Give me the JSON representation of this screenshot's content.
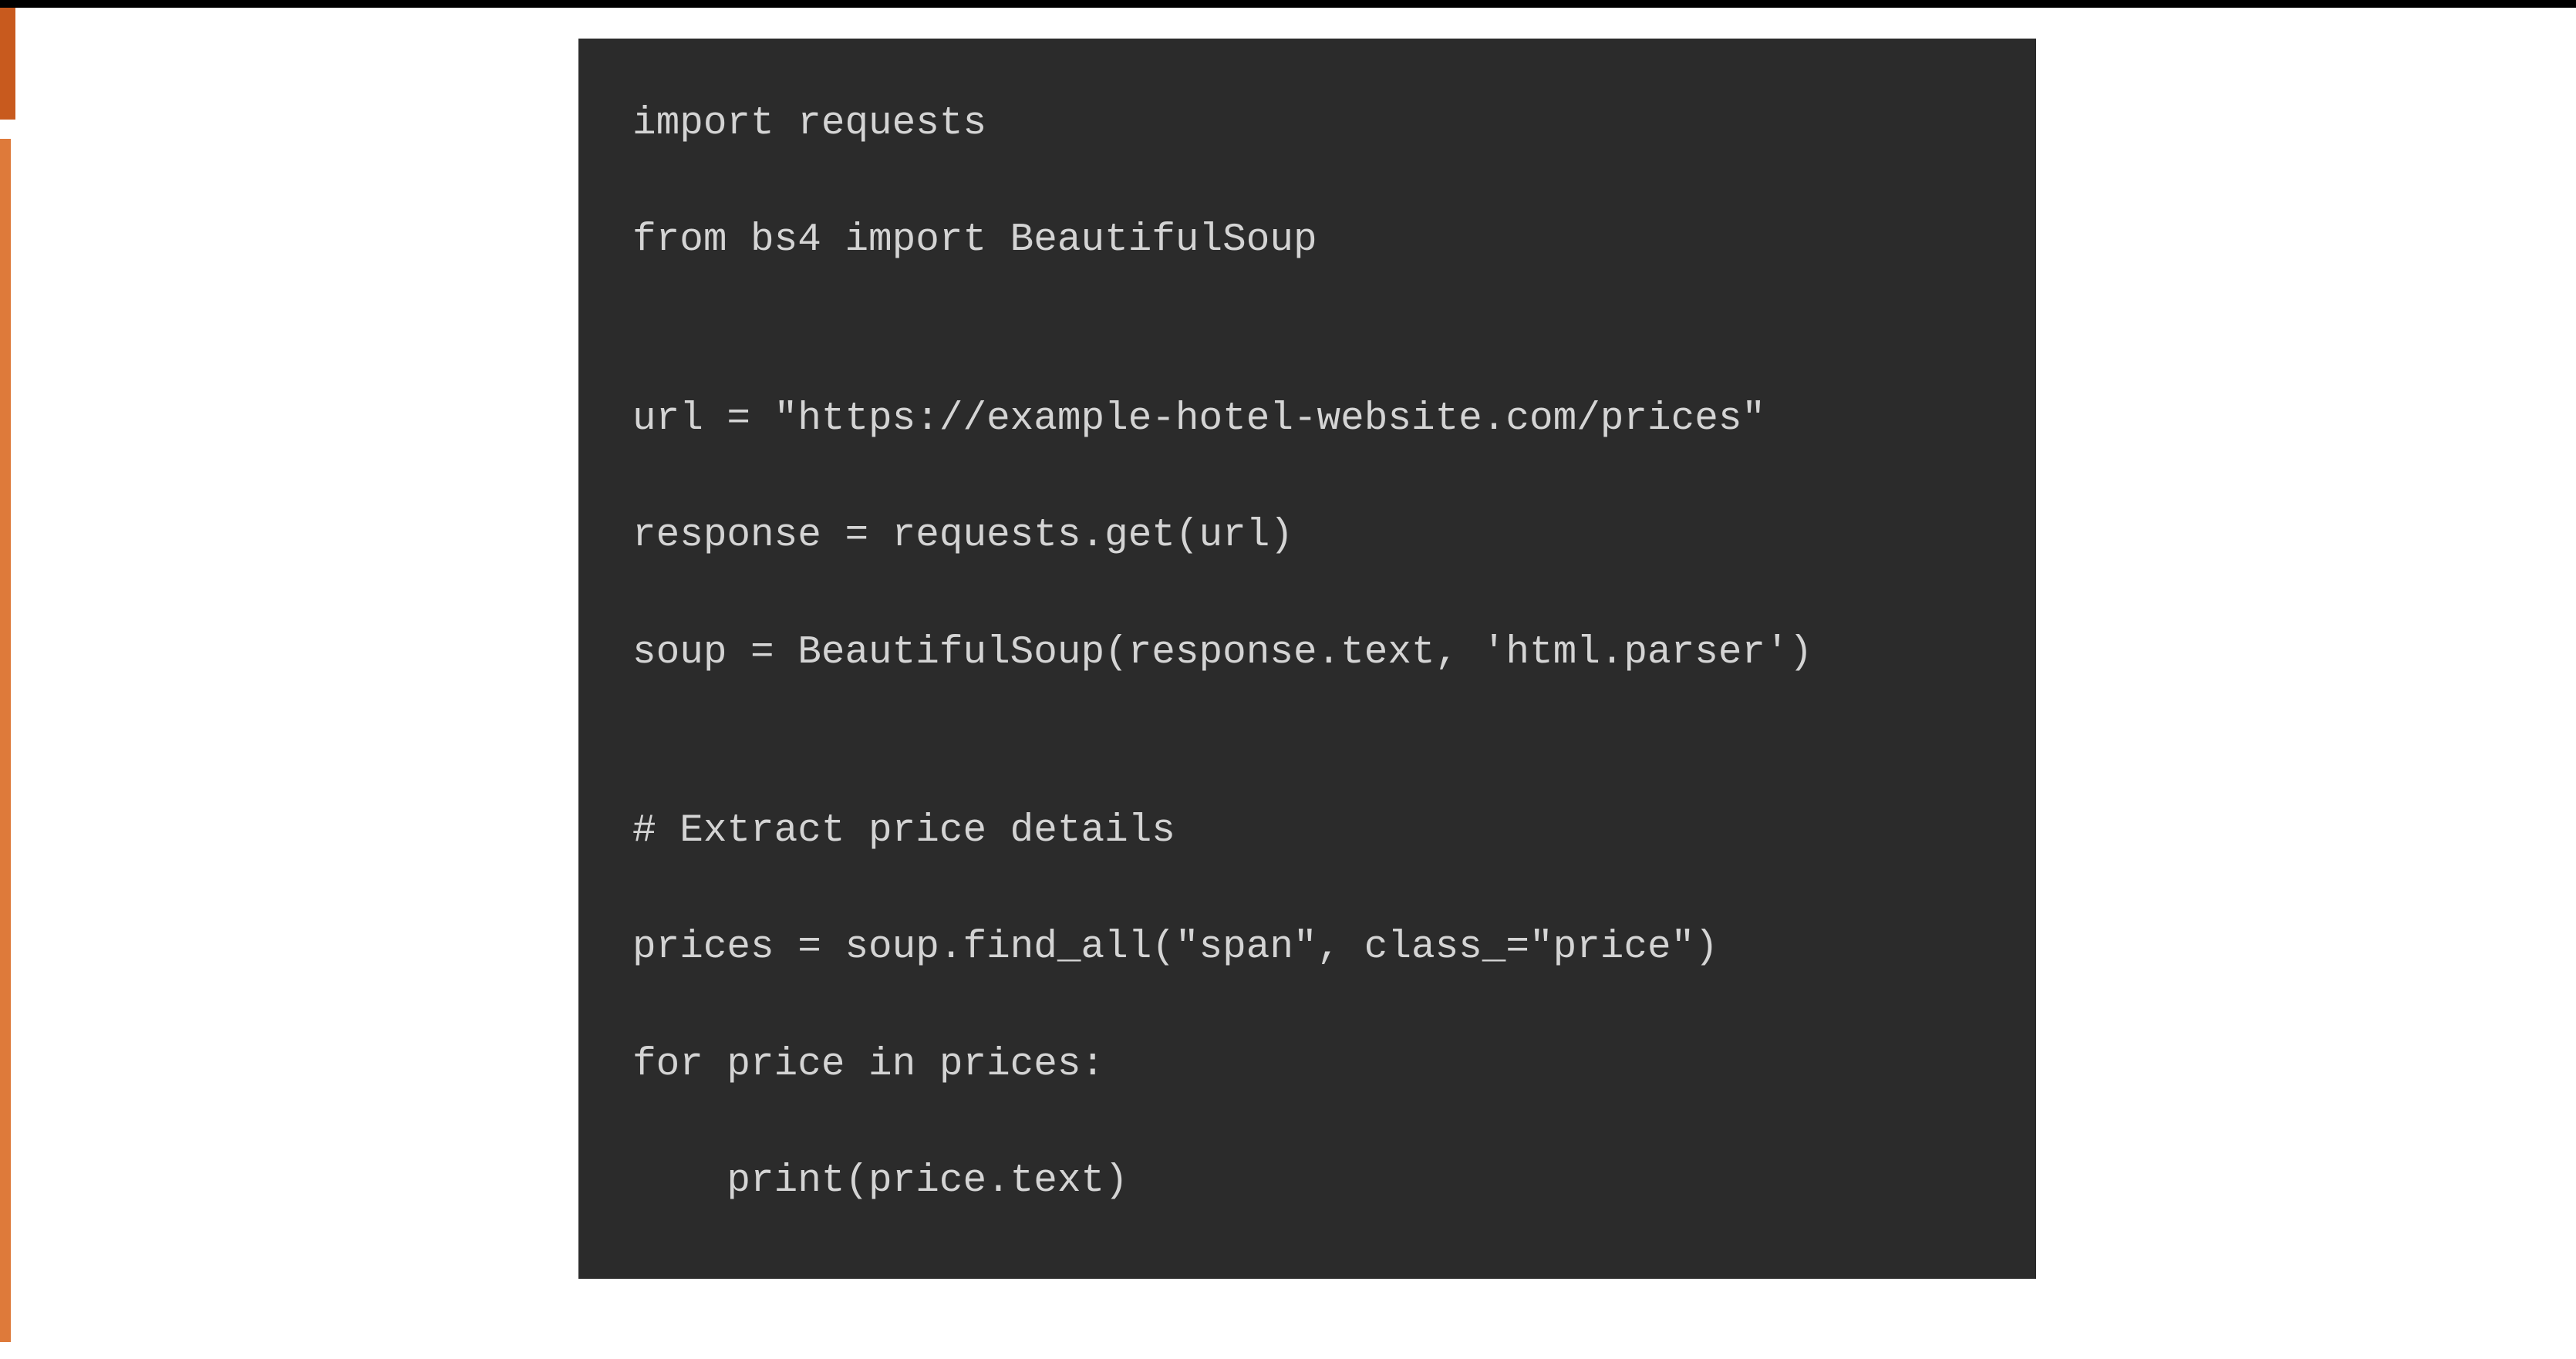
{
  "code": {
    "lines": [
      "import requests",
      "from bs4 import BeautifulSoup",
      "",
      "url = \"https://example-hotel-website.com/prices\"",
      "response = requests.get(url)",
      "soup = BeautifulSoup(response.text, 'html.parser')",
      "",
      "# Extract price details",
      "prices = soup.find_all(\"span\", class_=\"price\")",
      "for price in prices:",
      "    print(price.text)"
    ]
  },
  "colors": {
    "code_bg": "#2b2b2b",
    "code_text": "#d4d4d4",
    "accent_dark": "#c85a1e",
    "accent_light": "#de7a3a",
    "top_bar": "#000000"
  }
}
